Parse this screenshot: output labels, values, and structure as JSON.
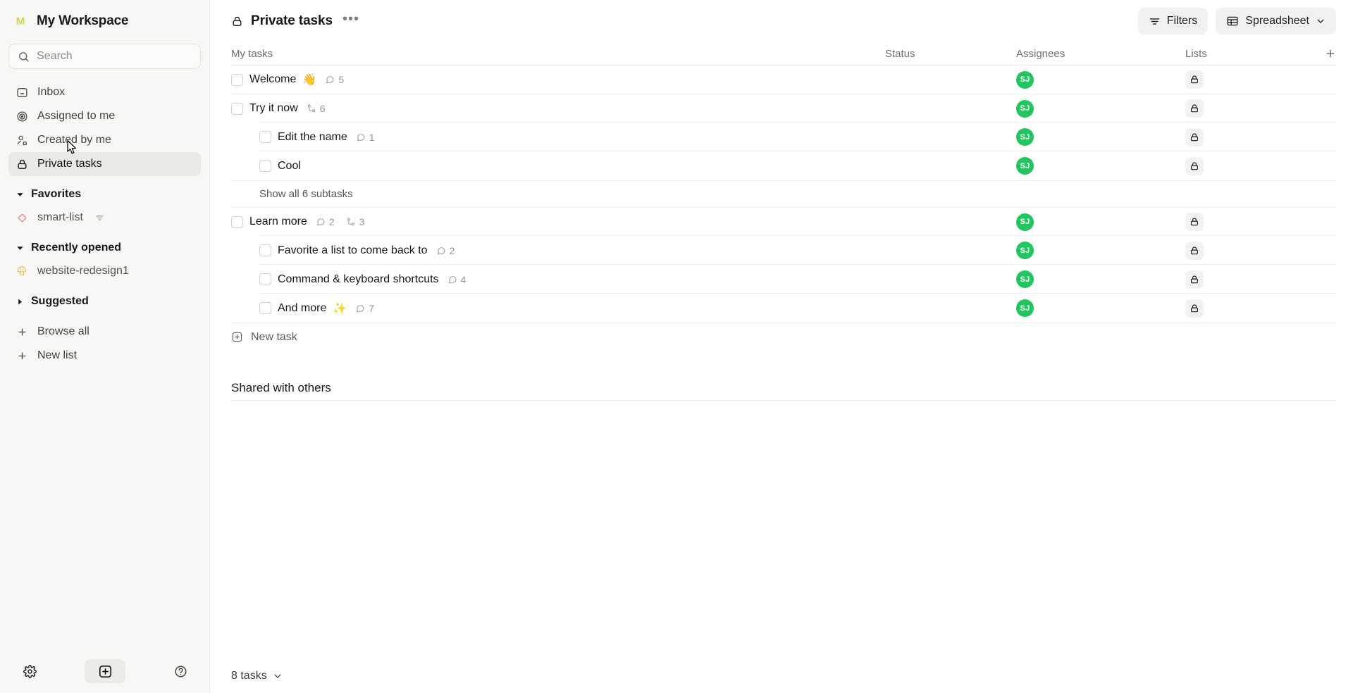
{
  "sidebar": {
    "workspace": {
      "badge_letter": "M",
      "name": "My Workspace"
    },
    "search": {
      "placeholder": "Search",
      "icon": "search-icon"
    },
    "nav": [
      {
        "label": "Inbox",
        "icon": "inbox-icon",
        "active": false
      },
      {
        "label": "Assigned to me",
        "icon": "target-icon",
        "active": false
      },
      {
        "label": "Created by me",
        "icon": "user-edit-icon",
        "active": false
      },
      {
        "label": "Private tasks",
        "icon": "lock-icon",
        "active": true
      }
    ],
    "sections": [
      {
        "label": "Favorites",
        "expanded": true,
        "items": [
          {
            "label": "smart-list",
            "icon": "diamond-icon",
            "icon_color": "#ef8275",
            "trailing_icon": "filter-icon"
          }
        ]
      },
      {
        "label": "Recently opened",
        "expanded": true,
        "items": [
          {
            "label": "website-redesign1",
            "icon": "mushroom-icon",
            "icon_color": "#e3c14e",
            "trailing_icon": ""
          }
        ]
      },
      {
        "label": "Suggested",
        "expanded": false,
        "items": []
      }
    ],
    "actions": [
      {
        "label": "Browse all",
        "icon": "plus-icon"
      },
      {
        "label": "New list",
        "icon": "plus-icon"
      }
    ],
    "footer": [
      {
        "icon": "gear-icon",
        "name": "settings-button",
        "active": false
      },
      {
        "icon": "plus-square-icon",
        "name": "create-button",
        "active": true
      },
      {
        "icon": "help-circle-icon",
        "name": "help-button",
        "active": false
      }
    ]
  },
  "topbar": {
    "icon": "lock-icon",
    "title": "Private tasks",
    "more_label": "•••",
    "filters_label": "Filters",
    "view_label": "Spreadsheet"
  },
  "table": {
    "columns": {
      "name": "My tasks",
      "status": "Status",
      "assignees": "Assignees",
      "lists": "Lists",
      "add": "+"
    },
    "rows": [
      {
        "name": "Welcome",
        "emoji": "👋",
        "indent": 0,
        "comments": "5",
        "subtasks": "",
        "assignee": "SJ",
        "list_icon": "lock-icon"
      },
      {
        "name": "Try it now",
        "emoji": "",
        "indent": 0,
        "comments": "",
        "subtasks": "6",
        "assignee": "SJ",
        "list_icon": "lock-icon"
      },
      {
        "name": "Edit the name",
        "emoji": "",
        "indent": 1,
        "comments": "1",
        "subtasks": "",
        "assignee": "SJ",
        "list_icon": "lock-icon"
      },
      {
        "name": "Cool",
        "emoji": "",
        "indent": 1,
        "comments": "",
        "subtasks": "",
        "assignee": "SJ",
        "list_icon": "lock-icon"
      }
    ],
    "show_all_label": "Show all 6 subtasks",
    "rows2": [
      {
        "name": "Learn more",
        "emoji": "",
        "indent": 0,
        "comments": "2",
        "subtasks": "3",
        "assignee": "SJ",
        "list_icon": "lock-icon"
      },
      {
        "name": "Favorite a list to come back to",
        "emoji": "",
        "indent": 1,
        "comments": "2",
        "subtasks": "",
        "assignee": "SJ",
        "list_icon": "lock-icon"
      },
      {
        "name": "Command & keyboard shortcuts",
        "emoji": "",
        "indent": 1,
        "comments": "4",
        "subtasks": "",
        "assignee": "SJ",
        "list_icon": "lock-icon"
      },
      {
        "name": "And more",
        "emoji": "✨",
        "indent": 1,
        "comments": "7",
        "subtasks": "",
        "assignee": "SJ",
        "list_icon": "lock-icon"
      }
    ],
    "new_task_label": "New task",
    "group2_title": "Shared with others"
  },
  "footer": {
    "task_count_label": "8 tasks"
  },
  "colors": {
    "accent_green": "#22c55e",
    "sidebar_bg": "#f7f7f5",
    "active_bg": "#e9e9e6"
  }
}
